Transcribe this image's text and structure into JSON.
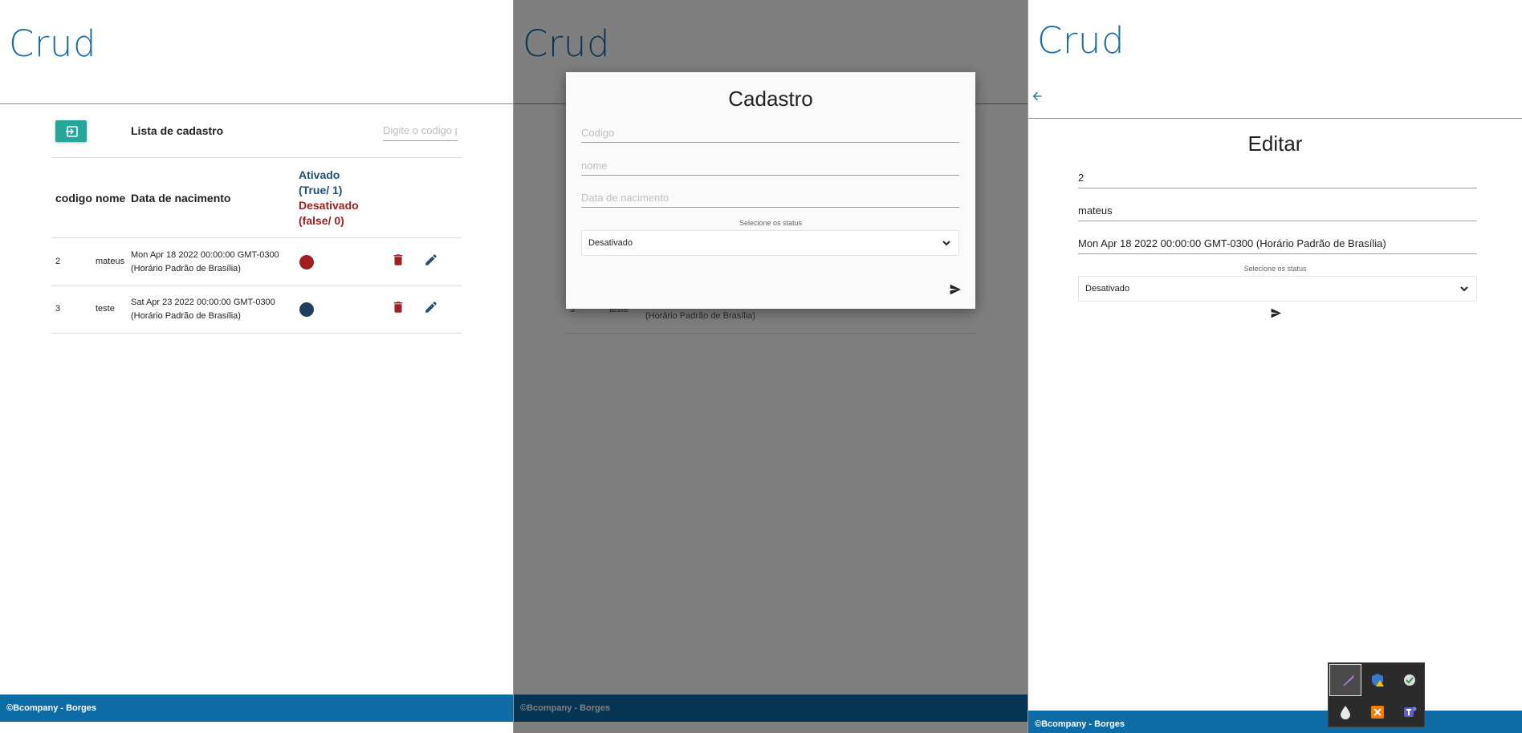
{
  "brand": "Crud",
  "footer_text": "©Bcompany - Borges",
  "list": {
    "title": "Lista de cadastro",
    "search_placeholder": "Digite o codigo para pesquisar",
    "columns": {
      "codigo": "codigo",
      "nome": "nome",
      "data": "Data de nacimento",
      "status_on": "Ativado (True/ 1)",
      "status_off": "Desativado (false/ 0)"
    },
    "rows": [
      {
        "codigo": "2",
        "nome": "mateus",
        "data_line1": "Mon Apr 18 2022 00:00:00 GMT-0300",
        "data_line2": "(Horário Padrão de Brasília)",
        "status": "off"
      },
      {
        "codigo": "3",
        "nome": "teste",
        "data_line1": "Sat Apr 23 2022 00:00:00 GMT-0300",
        "data_line2": "(Horário Padrão de Brasília)",
        "status": "on"
      }
    ]
  },
  "modal": {
    "title": "Cadastro",
    "codigo_placeholder": "Codigo",
    "nome_placeholder": "nome",
    "data_placeholder": "Data de nacimento",
    "select_label": "Selecione os status",
    "select_value": "Desativado"
  },
  "background_list": {
    "codigo": "3",
    "nome": "teste",
    "data_line2": "(Horário Padrão de Brasília)"
  },
  "edit": {
    "title": "Editar",
    "codigo_value": "2",
    "nome_value": "mateus",
    "data_value": "Mon Apr 18 2022 00:00:00 GMT-0300 (Horário Padrão de Brasília)",
    "select_label": "Selecione os status",
    "select_value": "Desativado"
  },
  "colors": {
    "brand": "#1a6ea8",
    "footer": "#0d6ca6",
    "exit_button": "#26a69a",
    "status_active": "#1f4e79",
    "status_inactive": "#a02020",
    "edit_icon": "#1f4e79",
    "delete_icon": "#a02020"
  },
  "tray_icons": [
    "pen-icon",
    "shield-warning-icon",
    "shield-check-icon",
    "water-drop-icon",
    "xampp-icon",
    "teams-icon"
  ]
}
